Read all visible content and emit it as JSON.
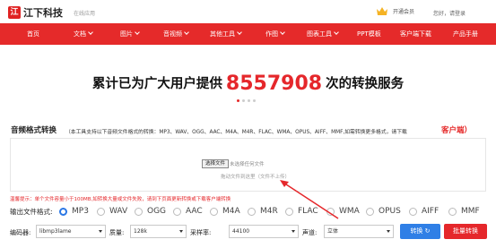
{
  "header": {
    "logo_mark": "江",
    "logo_text": "江下科技",
    "logo_sub": "在线应用",
    "vip_label": "开通会员",
    "login_label": "您好，请登录"
  },
  "nav": {
    "items": [
      {
        "label": "首页",
        "dropdown": false
      },
      {
        "label": "文档",
        "dropdown": true
      },
      {
        "label": "图片",
        "dropdown": true
      },
      {
        "label": "音视频",
        "dropdown": true
      },
      {
        "label": "其他工具",
        "dropdown": true
      },
      {
        "label": "作图",
        "dropdown": true
      },
      {
        "label": "图表工具",
        "dropdown": true
      },
      {
        "label": "PPT模板",
        "dropdown": false
      },
      {
        "label": "客户端下载",
        "dropdown": false
      },
      {
        "label": "产品手册",
        "dropdown": false
      }
    ]
  },
  "banner": {
    "prefix": "累计已为广大用户提供",
    "count": "8557908",
    "suffix": "次的转换服务",
    "slides": 4,
    "active_slide": 1
  },
  "section": {
    "title": "音频格式转换",
    "note": "（本工具支持以下音频文件格式的转换：MP3、WAV、OGG、AAC、M4A、M4R、FLAC、WMA、OPUS、AIFF、MMF,如需转换更多格式，请下载",
    "client_link": "客户端）"
  },
  "upload": {
    "choose_label": "选择文件",
    "no_file_label": "未选择任何文件",
    "drag_hint": "拖动文件到这里（文件不上传）"
  },
  "tip": "温馨提示：单个文件容量小于100MB,如转换大量或文件失败，请到下页面更新转换或下载客户端转换",
  "format": {
    "label": "输出文件格式:",
    "options": [
      "MP3",
      "WAV",
      "OGG",
      "AAC",
      "M4A",
      "M4R",
      "FLAC",
      "WMA",
      "OPUS",
      "AIFF",
      "MMF"
    ],
    "selected": "MP3"
  },
  "settings": {
    "encoder_label": "编码器:",
    "encoder_value": "libmp3lame",
    "quality_label": "质量:",
    "quality_value": "128k",
    "samplerate_label": "采样率:",
    "samplerate_value": "44100",
    "channel_label": "声道:",
    "channel_value": "立体",
    "convert_label": "转换",
    "batch_label": "批量转换"
  },
  "colors": {
    "brand_red": "#e52a2a",
    "convert_blue": "#2f7fe6",
    "radio_selected": "#2a77e5"
  }
}
